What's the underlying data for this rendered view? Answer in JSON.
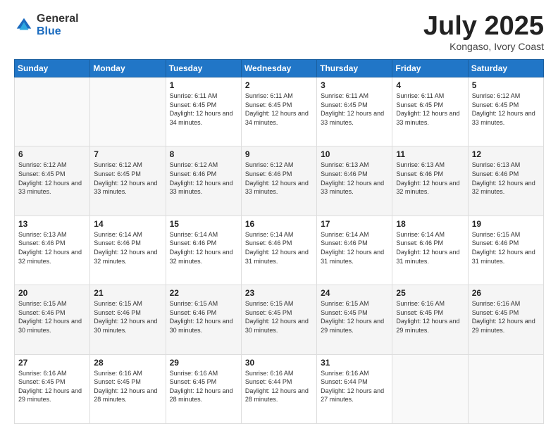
{
  "logo": {
    "general": "General",
    "blue": "Blue"
  },
  "header": {
    "month": "July 2025",
    "location": "Kongaso, Ivory Coast"
  },
  "weekdays": [
    "Sunday",
    "Monday",
    "Tuesday",
    "Wednesday",
    "Thursday",
    "Friday",
    "Saturday"
  ],
  "weeks": [
    [
      {
        "day": "",
        "info": ""
      },
      {
        "day": "",
        "info": ""
      },
      {
        "day": "1",
        "info": "Sunrise: 6:11 AM\nSunset: 6:45 PM\nDaylight: 12 hours and 34 minutes."
      },
      {
        "day": "2",
        "info": "Sunrise: 6:11 AM\nSunset: 6:45 PM\nDaylight: 12 hours and 34 minutes."
      },
      {
        "day": "3",
        "info": "Sunrise: 6:11 AM\nSunset: 6:45 PM\nDaylight: 12 hours and 33 minutes."
      },
      {
        "day": "4",
        "info": "Sunrise: 6:11 AM\nSunset: 6:45 PM\nDaylight: 12 hours and 33 minutes."
      },
      {
        "day": "5",
        "info": "Sunrise: 6:12 AM\nSunset: 6:45 PM\nDaylight: 12 hours and 33 minutes."
      }
    ],
    [
      {
        "day": "6",
        "info": "Sunrise: 6:12 AM\nSunset: 6:45 PM\nDaylight: 12 hours and 33 minutes."
      },
      {
        "day": "7",
        "info": "Sunrise: 6:12 AM\nSunset: 6:45 PM\nDaylight: 12 hours and 33 minutes."
      },
      {
        "day": "8",
        "info": "Sunrise: 6:12 AM\nSunset: 6:46 PM\nDaylight: 12 hours and 33 minutes."
      },
      {
        "day": "9",
        "info": "Sunrise: 6:12 AM\nSunset: 6:46 PM\nDaylight: 12 hours and 33 minutes."
      },
      {
        "day": "10",
        "info": "Sunrise: 6:13 AM\nSunset: 6:46 PM\nDaylight: 12 hours and 33 minutes."
      },
      {
        "day": "11",
        "info": "Sunrise: 6:13 AM\nSunset: 6:46 PM\nDaylight: 12 hours and 32 minutes."
      },
      {
        "day": "12",
        "info": "Sunrise: 6:13 AM\nSunset: 6:46 PM\nDaylight: 12 hours and 32 minutes."
      }
    ],
    [
      {
        "day": "13",
        "info": "Sunrise: 6:13 AM\nSunset: 6:46 PM\nDaylight: 12 hours and 32 minutes."
      },
      {
        "day": "14",
        "info": "Sunrise: 6:14 AM\nSunset: 6:46 PM\nDaylight: 12 hours and 32 minutes."
      },
      {
        "day": "15",
        "info": "Sunrise: 6:14 AM\nSunset: 6:46 PM\nDaylight: 12 hours and 32 minutes."
      },
      {
        "day": "16",
        "info": "Sunrise: 6:14 AM\nSunset: 6:46 PM\nDaylight: 12 hours and 31 minutes."
      },
      {
        "day": "17",
        "info": "Sunrise: 6:14 AM\nSunset: 6:46 PM\nDaylight: 12 hours and 31 minutes."
      },
      {
        "day": "18",
        "info": "Sunrise: 6:14 AM\nSunset: 6:46 PM\nDaylight: 12 hours and 31 minutes."
      },
      {
        "day": "19",
        "info": "Sunrise: 6:15 AM\nSunset: 6:46 PM\nDaylight: 12 hours and 31 minutes."
      }
    ],
    [
      {
        "day": "20",
        "info": "Sunrise: 6:15 AM\nSunset: 6:46 PM\nDaylight: 12 hours and 30 minutes."
      },
      {
        "day": "21",
        "info": "Sunrise: 6:15 AM\nSunset: 6:46 PM\nDaylight: 12 hours and 30 minutes."
      },
      {
        "day": "22",
        "info": "Sunrise: 6:15 AM\nSunset: 6:46 PM\nDaylight: 12 hours and 30 minutes."
      },
      {
        "day": "23",
        "info": "Sunrise: 6:15 AM\nSunset: 6:45 PM\nDaylight: 12 hours and 30 minutes."
      },
      {
        "day": "24",
        "info": "Sunrise: 6:15 AM\nSunset: 6:45 PM\nDaylight: 12 hours and 29 minutes."
      },
      {
        "day": "25",
        "info": "Sunrise: 6:16 AM\nSunset: 6:45 PM\nDaylight: 12 hours and 29 minutes."
      },
      {
        "day": "26",
        "info": "Sunrise: 6:16 AM\nSunset: 6:45 PM\nDaylight: 12 hours and 29 minutes."
      }
    ],
    [
      {
        "day": "27",
        "info": "Sunrise: 6:16 AM\nSunset: 6:45 PM\nDaylight: 12 hours and 29 minutes."
      },
      {
        "day": "28",
        "info": "Sunrise: 6:16 AM\nSunset: 6:45 PM\nDaylight: 12 hours and 28 minutes."
      },
      {
        "day": "29",
        "info": "Sunrise: 6:16 AM\nSunset: 6:45 PM\nDaylight: 12 hours and 28 minutes."
      },
      {
        "day": "30",
        "info": "Sunrise: 6:16 AM\nSunset: 6:44 PM\nDaylight: 12 hours and 28 minutes."
      },
      {
        "day": "31",
        "info": "Sunrise: 6:16 AM\nSunset: 6:44 PM\nDaylight: 12 hours and 27 minutes."
      },
      {
        "day": "",
        "info": ""
      },
      {
        "day": "",
        "info": ""
      }
    ]
  ]
}
